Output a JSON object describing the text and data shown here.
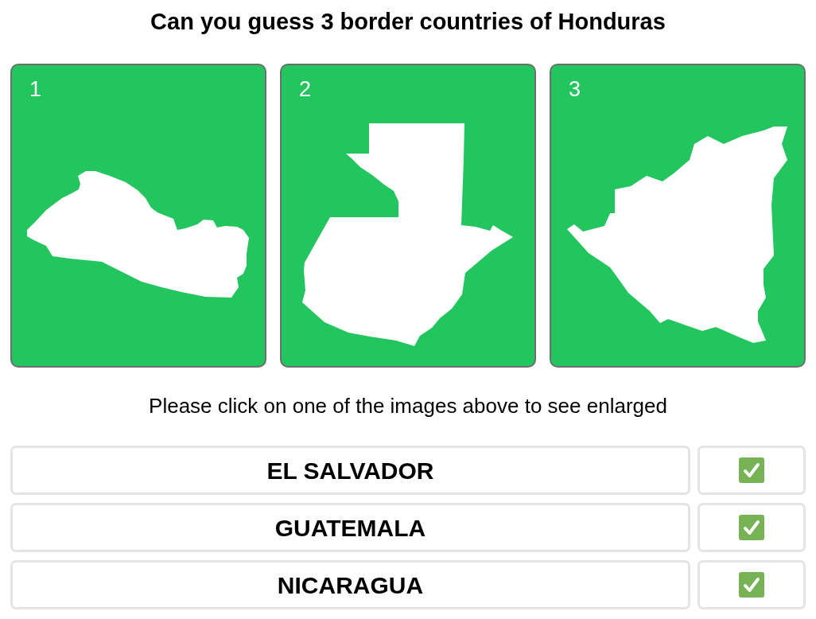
{
  "title": "Can you guess 3 border countries of Honduras",
  "cards": [
    {
      "number": "1",
      "kind": "salvador"
    },
    {
      "number": "2",
      "kind": "guatemala"
    },
    {
      "number": "3",
      "kind": "nicaragua"
    }
  ],
  "instruction": "Please click on one of the images above to see enlarged",
  "answers": [
    {
      "name": "EL SALVADOR",
      "checked": true
    },
    {
      "name": "GUATEMALA",
      "checked": true
    },
    {
      "name": "NICARAGUA",
      "checked": true
    }
  ]
}
